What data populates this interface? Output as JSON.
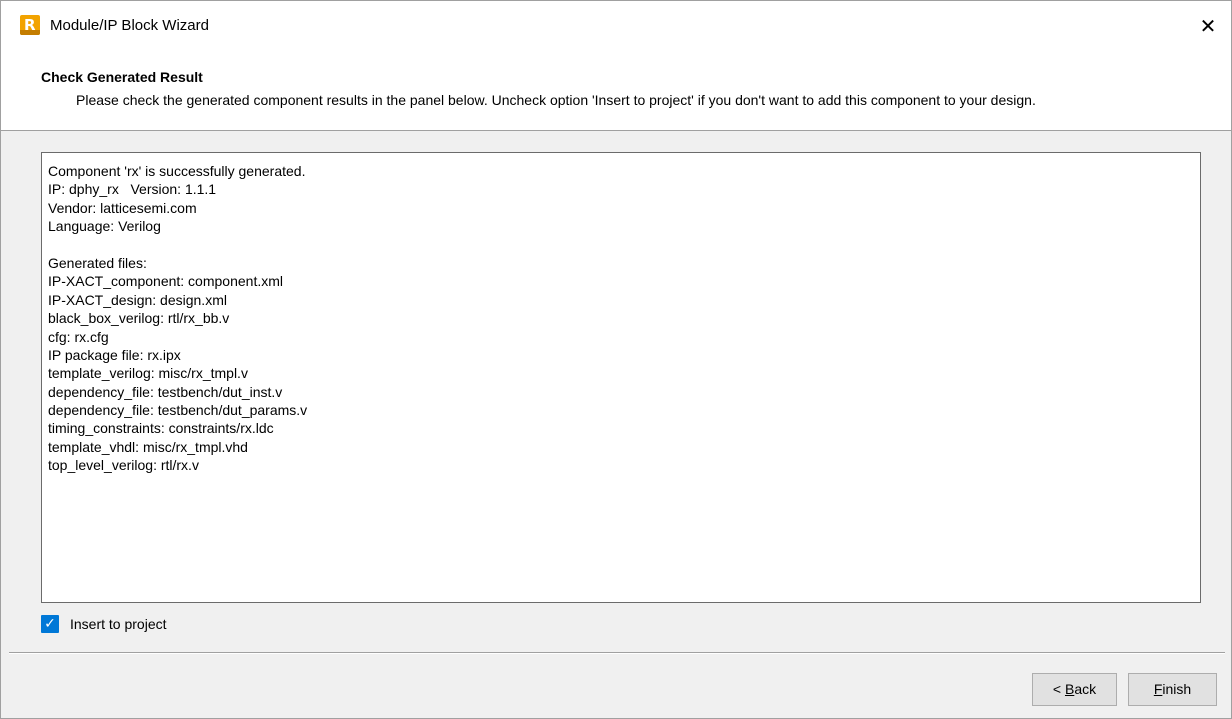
{
  "window": {
    "title": "Module/IP Block Wizard",
    "close_glyph": "✕",
    "app_icon": "lattice-radiant-icon",
    "app_icon_letter": "R"
  },
  "header": {
    "title": "Check Generated Result",
    "description": "Please check the generated component results in the panel below. Uncheck option 'Insert to project' if you don't want to add this component to your design."
  },
  "result_panel": {
    "lines": [
      "Component 'rx' is successfully generated.",
      "IP: dphy_rx   Version: 1.1.1",
      "Vendor: latticesemi.com",
      "Language: Verilog",
      "",
      "Generated files:",
      "IP-XACT_component: component.xml",
      "IP-XACT_design: design.xml",
      "black_box_verilog: rtl/rx_bb.v",
      "cfg: rx.cfg",
      "IP package file: rx.ipx",
      "template_verilog: misc/rx_tmpl.v",
      "dependency_file: testbench/dut_inst.v",
      "dependency_file: testbench/dut_params.v",
      "timing_constraints: constraints/rx.ldc",
      "template_vhdl: misc/rx_tmpl.vhd",
      "top_level_verilog: rtl/rx.v"
    ]
  },
  "insert_option": {
    "label": "Insert to project",
    "checked": true,
    "check_glyph": "✓"
  },
  "buttons": {
    "back": {
      "prefix": "< ",
      "mnemonic": "B",
      "rest": "ack"
    },
    "finish": {
      "prefix": "",
      "mnemonic": "F",
      "rest": "inish"
    }
  },
  "colors": {
    "accent": "#0078d7",
    "icon": "#f2a300"
  }
}
